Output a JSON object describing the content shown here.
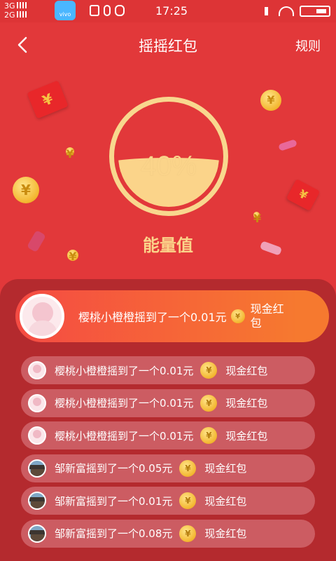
{
  "status_bar": {
    "network_top": "3G",
    "network_bottom": "2G",
    "store_label": "vivo",
    "time": "17:25"
  },
  "header": {
    "title": "摇摇红包",
    "rules_label": "规则"
  },
  "energy": {
    "percent_text": "40%",
    "percent_value": 0.4,
    "label": "能量值"
  },
  "highlight": {
    "text": "樱桃小橙橙摇到了一个0.01元",
    "coin_symbol": "¥",
    "type": "现金红包"
  },
  "records": [
    {
      "text": "樱桃小橙橙摇到了一个0.01元",
      "type": "现金红包",
      "avatar": "girl"
    },
    {
      "text": "樱桃小橙橙摇到了一个0.01元",
      "type": "现金红包",
      "avatar": "girl"
    },
    {
      "text": "樱桃小橙橙摇到了一个0.01元",
      "type": "现金红包",
      "avatar": "girl"
    },
    {
      "text": "邹新富摇到了一个0.05元",
      "type": "现金红包",
      "avatar": "house"
    },
    {
      "text": "邹新富摇到了一个0.01元",
      "type": "现金红包",
      "avatar": "house"
    },
    {
      "text": "邹新富摇到了一个0.08元",
      "type": "现金红包",
      "avatar": "house"
    }
  ],
  "colors": {
    "background": "#e2383a",
    "gold": "#fbd48a",
    "panel": "#b42a2e",
    "row": "#cc5c62"
  }
}
